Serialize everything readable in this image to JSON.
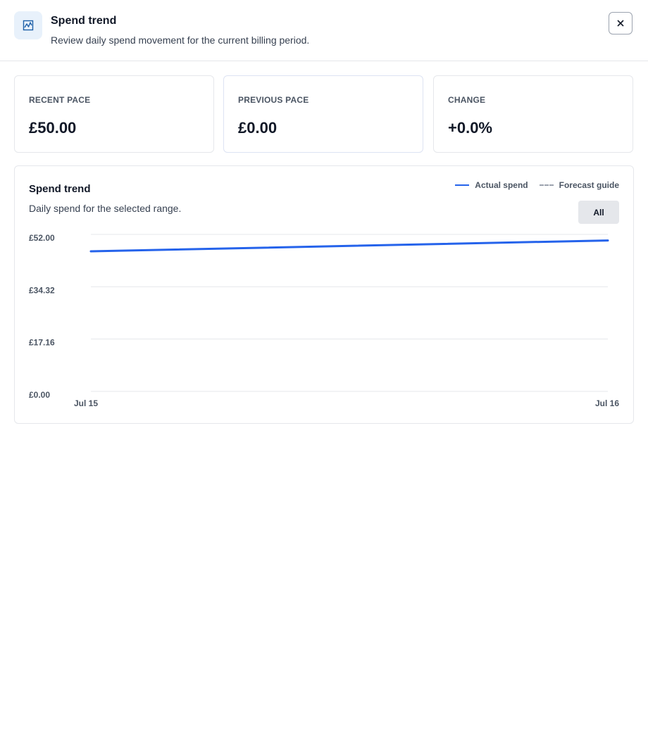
{
  "header": {
    "title": "Spend trend",
    "subtitle": "Review daily spend movement for the current billing period."
  },
  "stats": [
    {
      "label": "RECENT PACE",
      "value": "£50.00"
    },
    {
      "label": "PREVIOUS PACE",
      "value": "£0.00"
    },
    {
      "label": "CHANGE",
      "value": "+0.0%"
    }
  ],
  "chart": {
    "title": "Spend trend",
    "subtitle": "Daily spend for the selected range.",
    "legend": [
      {
        "label": "Actual spend",
        "style": "solid",
        "color": "#2563eb"
      },
      {
        "label": "Forecast guide",
        "style": "dashed",
        "color": "#9ca3af"
      }
    ],
    "range_button": "All"
  },
  "chart_data": {
    "type": "line",
    "x": [
      "Jul 15",
      "Jul 16"
    ],
    "series": [
      {
        "name": "Actual spend",
        "values": [
          46.4,
          50.0
        ]
      }
    ],
    "ylim": [
      0,
      52
    ],
    "yticks": [
      "£52.00",
      "£34.32",
      "£17.16",
      "£0.00"
    ],
    "xticks": [
      "Jul 15",
      "Jul 16"
    ],
    "grid": true,
    "legend_position": "top-right"
  }
}
